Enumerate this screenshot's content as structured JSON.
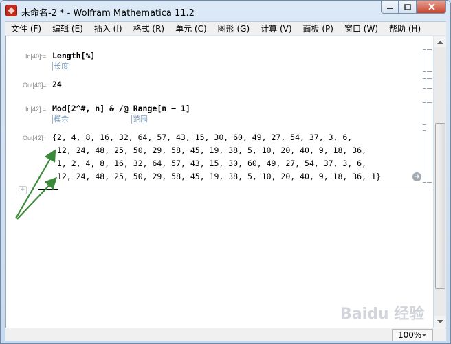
{
  "window": {
    "title": "未命名-2 * - Wolfram Mathematica 11.2",
    "controls": {
      "minimize": "minimize",
      "restore": "restore",
      "close": "close"
    }
  },
  "menu": [
    "文件 (F)",
    "编辑 (E)",
    "插入 (I)",
    "格式 (R)",
    "单元 (C)",
    "图形 (G)",
    "计算 (V)",
    "面板 (P)",
    "窗口 (W)",
    "帮助 (H)"
  ],
  "cells": {
    "in40": {
      "label": "In[40]:=",
      "code": "Length[%]",
      "hint": "长度"
    },
    "out40": {
      "label": "Out[40]=",
      "value": "24"
    },
    "in42": {
      "label": "In[42]:=",
      "code": "Mod[2^#, n] & /@ Range[n − 1]",
      "hint1": "模余",
      "hint2": "范围"
    },
    "out42": {
      "label": "Out[42]=",
      "lines": [
        "{2, 4, 8, 16, 32, 64, 57, 43, 15, 30, 60, 49, 27, 54, 37, 3, 6,",
        "12, 24, 48, 25, 50, 29, 58, 45, 19, 38, 5, 10, 20, 40, 9, 18, 36,",
        "1, 2, 4, 8, 16, 32, 64, 57, 43, 15, 30, 60, 49, 27, 54, 37, 3, 6,",
        "12, 24, 48, 25, 50, 29, 58, 45, 19, 38, 5, 10, 20, 40, 9, 18, 36, 1}"
      ]
    }
  },
  "insert_plus": "+",
  "status": {
    "zoom": "100%"
  },
  "watermark": "Baidu 经验",
  "annotation_color": "#3a8a3a"
}
